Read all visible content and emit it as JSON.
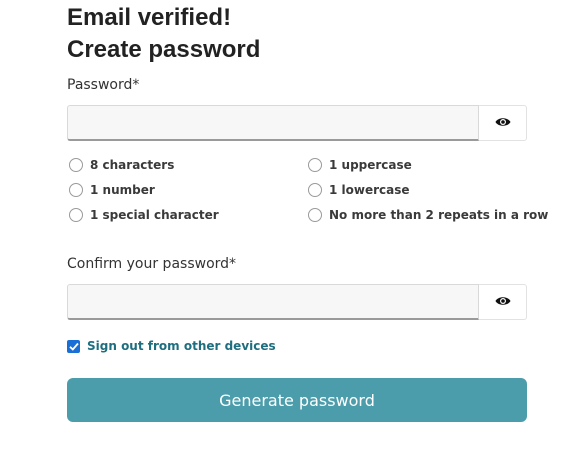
{
  "header": {
    "title_line1": "Email verified!",
    "title_line2": "Create password"
  },
  "password": {
    "label": "Password*",
    "value": "",
    "placeholder": "",
    "toggle_icon": "eye-icon"
  },
  "requirements": [
    {
      "label": "8 characters",
      "met": false
    },
    {
      "label": "1 uppercase",
      "met": false
    },
    {
      "label": "1 number",
      "met": false
    },
    {
      "label": "1 lowercase",
      "met": false
    },
    {
      "label": "1 special character",
      "met": false
    },
    {
      "label": "No more than 2 repeats in a row",
      "met": false
    }
  ],
  "confirm": {
    "label": "Confirm your password*",
    "value": "",
    "placeholder": "",
    "toggle_icon": "eye-icon"
  },
  "sign_out": {
    "label": "Sign out from other devices",
    "checked": true
  },
  "submit": {
    "label": "Generate password"
  },
  "colors": {
    "primary_button": "#4c9dab",
    "checkbox": "#1a6fd6",
    "link_text": "#1e6e80"
  }
}
